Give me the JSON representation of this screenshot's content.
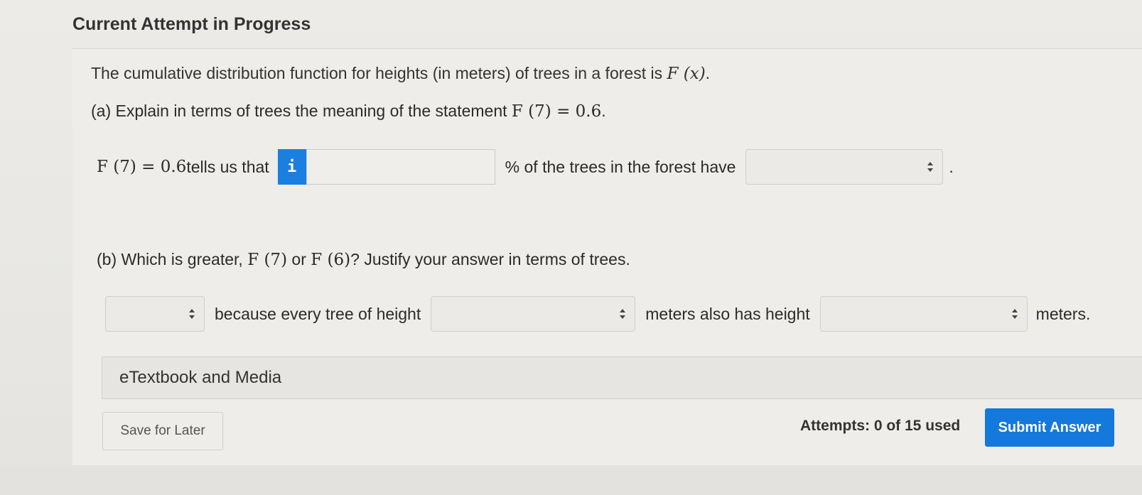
{
  "header": {
    "title": "Current Attempt in Progress"
  },
  "question": {
    "intro_text": "The cumulative distribution function for heights (in meters) of trees in a forest is ",
    "intro_math": "F (x)",
    "intro_end": ".",
    "part_a": {
      "prompt": "(a) Explain in terms of trees the meaning of the statement ",
      "prompt_math": "F (7) = 0.6",
      "prompt_end": ".",
      "answer_math": "F (7) = 0.6",
      "answer_text": " tells us that",
      "info_icon_glyph": "i",
      "percent_input_value": "",
      "after_input_text": "% of the trees in the forest have",
      "select_value": "",
      "end_punct": "."
    },
    "part_b": {
      "prompt": "(b) Which is greater, ",
      "prompt_math1": "F (7)",
      "prompt_or": " or ",
      "prompt_math2": "F (6)",
      "prompt_end": "? Justify your answer in terms of trees.",
      "select1_value": "",
      "text1": "because every tree of height",
      "select2_value": "",
      "text2": "meters also has height",
      "select3_value": "",
      "text3": "meters."
    }
  },
  "etextbook": {
    "label": "eTextbook and Media"
  },
  "footer": {
    "save_label": "Save for Later",
    "attempts_text": "Attempts: 0 of 15 used",
    "submit_label": "Submit Answer"
  },
  "colors": {
    "accent": "#1478dc",
    "info_button": "#1a7fe0",
    "background": "#e9e9e6"
  },
  "icons": {
    "info": "info-icon",
    "select_arrows": "updown-chevron-icon"
  }
}
